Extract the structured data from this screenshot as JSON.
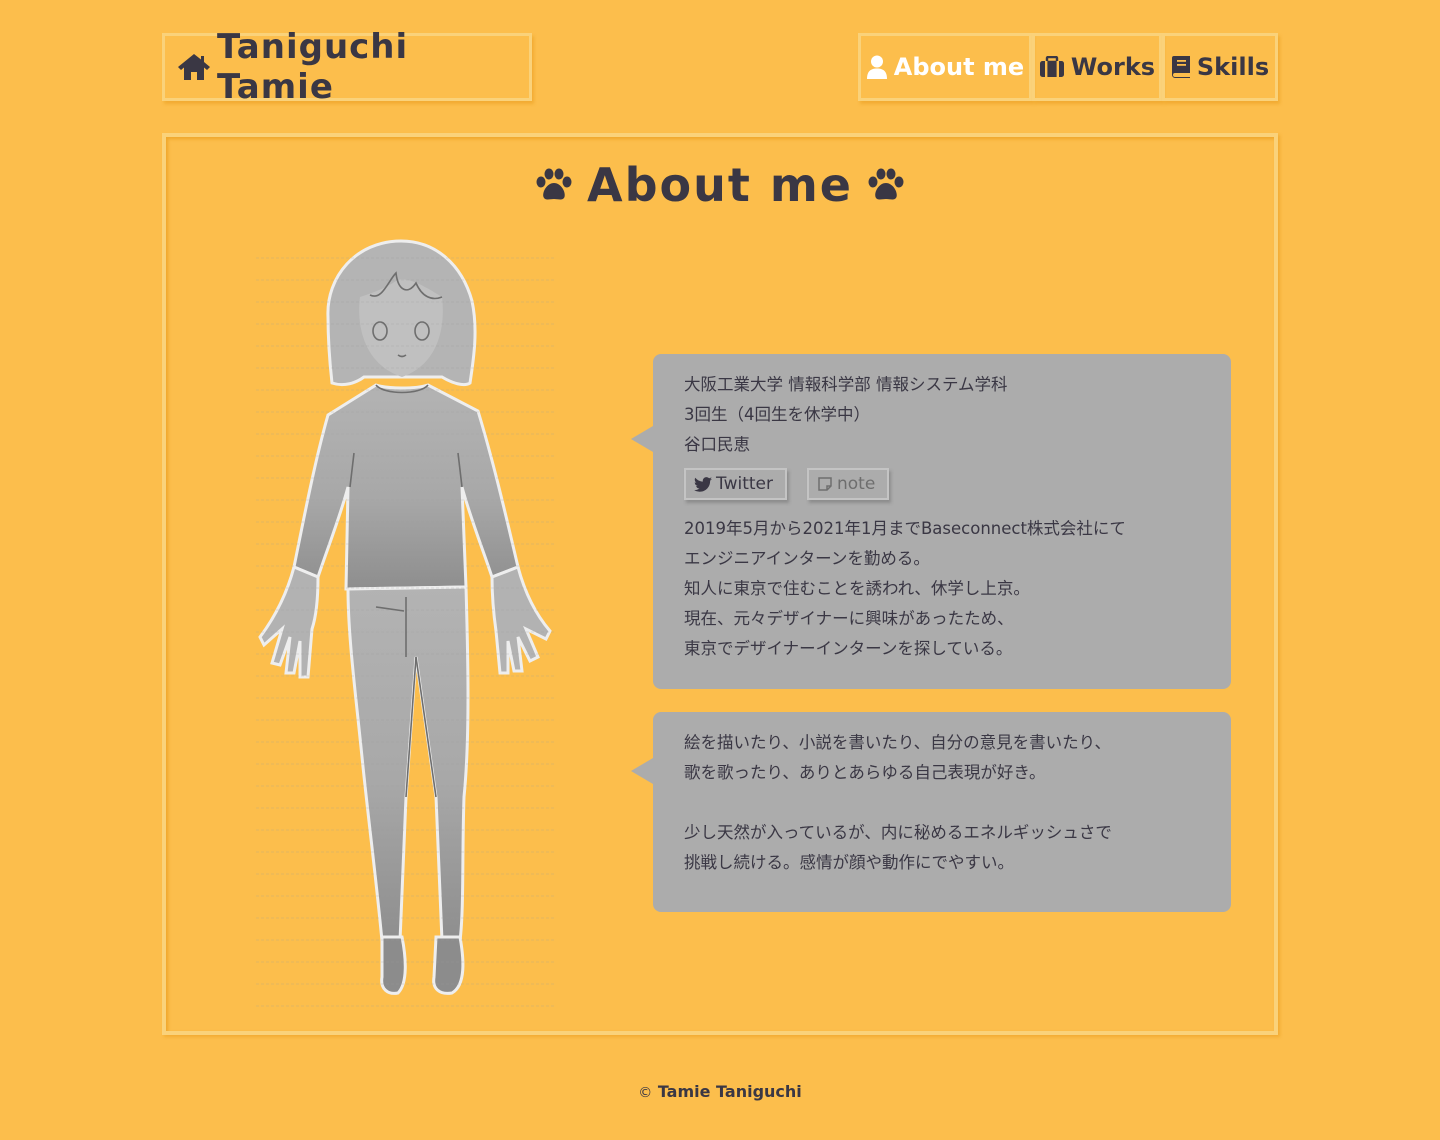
{
  "header": {
    "logo_text": "Taniguchi Tamie",
    "logo_icon": "home-icon"
  },
  "nav": {
    "items": [
      {
        "label": "About me",
        "icon": "user-icon",
        "active": true
      },
      {
        "label": "Works",
        "icon": "briefcase-icon",
        "active": false
      },
      {
        "label": "Skills",
        "icon": "book-icon",
        "active": false
      }
    ]
  },
  "main": {
    "title": "About me",
    "title_icon": "paw-icon",
    "bubble1": {
      "intro": [
        "大阪工業大学 情報科学部 情報システム学科",
        "3回生（4回生を休学中）",
        "谷口民恵"
      ],
      "links": [
        {
          "label": "Twitter",
          "icon": "twitter-icon"
        },
        {
          "label": "note",
          "icon": "note-icon"
        }
      ],
      "body": [
        "2019年5月から2021年1月までBaseconnect株式会社にて",
        "エンジニアインターンを勤める。",
        "知人に東京で住むことを誘われ、休学し上京。",
        "現在、元々デザイナーに興味があったため、",
        "東京でデザイナーインターンを探している。"
      ]
    },
    "bubble2": {
      "para1": [
        "絵を描いたり、小説を書いたり、自分の意見を書いたり、",
        "歌を歌ったり、ありとあらゆる自己表現が好き。"
      ],
      "para2": [
        "少し天然が入っているが、内に秘めるエネルギッシュさで",
        "挑戦し続ける。感情が顔や動作にでやすい。"
      ]
    }
  },
  "footer": {
    "copyright_symbol": "©",
    "text": "Tamie Taniguchi"
  },
  "colors": {
    "background": "#fcbe4c",
    "text": "#3a3744",
    "bubble": "#acacac",
    "frame": "#fad27a"
  }
}
